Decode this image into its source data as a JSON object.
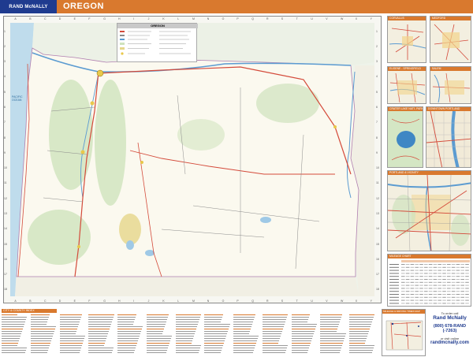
{
  "header": {
    "brand": "RAND McNALLY",
    "title": "OREGON",
    "color": "#d9792e",
    "brand_color": "#1f3b8f"
  },
  "map": {
    "top_ticks": [
      "A",
      "B",
      "C",
      "D",
      "E",
      "F",
      "G",
      "H",
      "I",
      "J",
      "K",
      "L",
      "M",
      "N",
      "O",
      "P",
      "Q",
      "R",
      "S",
      "T",
      "U",
      "V",
      "W",
      "X",
      "Y"
    ],
    "side_ticks": [
      "1",
      "2",
      "3",
      "4",
      "5",
      "6",
      "7",
      "8",
      "9",
      "10",
      "11",
      "12",
      "13",
      "14",
      "15",
      "16",
      "17",
      "18"
    ],
    "legend_title": "OREGON",
    "ocean_label": "PACIFIC OCEAN"
  },
  "insets": [
    {
      "title": "CORVALLIS"
    },
    {
      "title": "MEDFORD"
    },
    {
      "title": "EUGENE - SPRINGFIELD"
    },
    {
      "title": "SALEM"
    },
    {
      "title": "CRATER LAKE NAT'L PARK"
    },
    {
      "title": "DOWNTOWN PORTLAND"
    },
    {
      "title": "PORTLAND & VICINITY"
    }
  ],
  "mileage_title": "MILEAGE CHART",
  "index_title": "CITY & COUNTY INDEX",
  "drive_title": "MILEAGE & DRIVING TIMES MAP",
  "order": {
    "line1": "To order call",
    "line2": "Rand McNally",
    "line3": "(800) 678-RAND",
    "line4": "(-7263)",
    "line5": "or visit online",
    "line6": "randmcnally.com"
  }
}
